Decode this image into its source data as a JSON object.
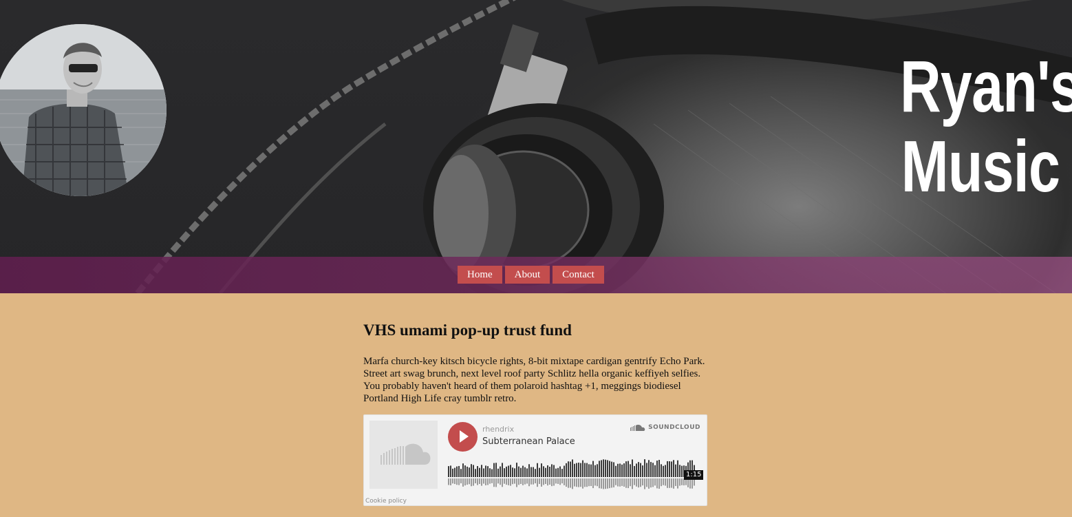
{
  "header": {
    "title_line1": "Ryan's",
    "title_line2": "Music"
  },
  "nav": {
    "items": [
      "Home",
      "About",
      "Contact"
    ]
  },
  "post": {
    "title": "VHS umami pop-up trust fund",
    "body": "Marfa church-key kitsch bicycle rights, 8-bit mixtape cardigan gentrify Echo Park. Street art swag brunch, next level roof party Schlitz hella organic keffiyeh selfies. You probably haven't heard of them polaroid hashtag +1, meggings biodiesel Portland High Life cray tumblr retro."
  },
  "player": {
    "user": "rhendrix",
    "track": "Subterranean Palace",
    "brand": "SOUNDCLOUD",
    "duration": "1:15",
    "cookie": "Cookie policy"
  },
  "colors": {
    "page_bg": "#dfb784",
    "nav_button": "#c34d4d",
    "nav_bar": "#6e285a",
    "play_button": "#c34d4d"
  }
}
